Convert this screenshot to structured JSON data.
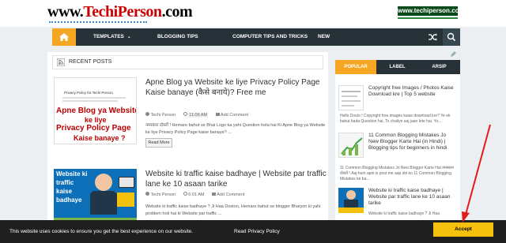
{
  "header": {
    "logo_prefix": "www.",
    "logo_brand_a": "Techi",
    "logo_brand_b": "Person",
    "logo_suffix": ".com",
    "badge_text": "www.techiperson.com"
  },
  "nav": {
    "home_icon": "home-icon",
    "items": [
      {
        "label": "TEMPLATES"
      },
      {
        "label": "BLOGGING TIPS"
      },
      {
        "label": "COMPUTER TIPS AND TRICKS"
      },
      {
        "label": "NEW"
      }
    ],
    "shuffle_icon": "shuffle-icon",
    "search_icon": "search-icon",
    "accent_color": "#f5a623"
  },
  "main": {
    "section_title": "RECENT POSTS",
    "posts": [
      {
        "title": "Apne Blog ya Website ke liye Privacy Policy Page Kaise banaye (कैसे बनाये)? Free me",
        "author": "Techi Person",
        "time": "11:06 AM",
        "comments": "Add Comment",
        "excerpt": "नमस्कार दोस्तों ! Hemare bahut se Bhai Logo ka yahi Question hota hai Ki Apne Blog ya Website ke liye Privacy Policy Page kaise banaye? ...",
        "read_more": "Read More",
        "thumb_text_1": "Apne Blog ya Website",
        "thumb_text_2": "ke liye",
        "thumb_text_3": "Privacy Policy Page",
        "thumb_text_4": "Kaise banaye ?",
        "thumb_caption": "Privacy Policy for Techi Person"
      },
      {
        "title": "Website ki traffic kaise badhaye | Website par traffic lane ke 10 asaan tarike",
        "author": "Techi Person",
        "time": "6:01 AM",
        "comments": "Add Comment",
        "excerpt": "Website ki traffic kaise badhaye ? Ji Haa Doston, Hemare bahut se blogger Bhaiyon ki yahi problem hoti hai ki Website par traffic ...",
        "thumb_text_1": "Website ki",
        "thumb_text_2": "traffic",
        "thumb_text_3": "kaise",
        "thumb_text_4": "badhaye"
      }
    ]
  },
  "sidebar": {
    "tabs": [
      {
        "label": "POPULAR"
      },
      {
        "label": "LABEL"
      },
      {
        "label": "ARSIP"
      }
    ],
    "items": [
      {
        "title": "Copyright free Images / Photos Kaise Download kre | Top 5 website",
        "desc": "Hello Dosto ! Copyright free images kaise download kre? Ye ek bahut bada Question hai, To chaliye aaj jaan lete hai. Yo..."
      },
      {
        "title": "11 Common Blogging Mistakes Jo New Blogger Karte Hai (in Hindi) | Blogging tips for beginners in hindi",
        "desc": "11 Common Blogging Mistakes Jo New Blogger Karte Hai नमस्कार दोस्तों ! Aaj hum apni is post me aap sbi ko 11 Common Blogging Mistakes ke ba..."
      },
      {
        "title": "Website ki traffic kaise badhaye | Website par traffic lane ke 10 asaan tarike",
        "desc": "Website ki traffic kaise badhaye ? Ji Haa"
      }
    ]
  },
  "cookie": {
    "text": "This website uses cookies to ensure you get the best experience on our website.",
    "link": "Read Privacy Policy",
    "accept": "Accept"
  }
}
